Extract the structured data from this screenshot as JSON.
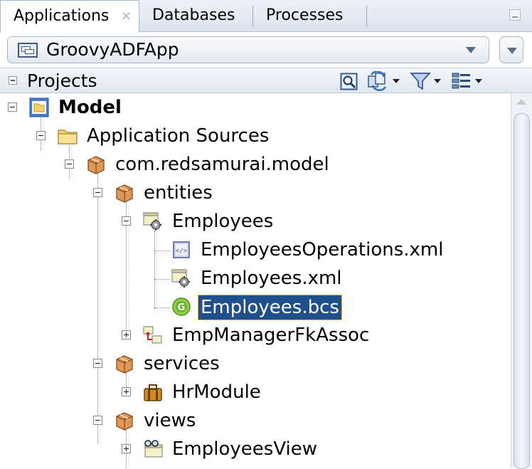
{
  "tabs": [
    {
      "label": "Applications",
      "close": "×"
    },
    {
      "label": "Databases"
    },
    {
      "label": "Processes"
    }
  ],
  "app_selector": {
    "value": "GroovyADFApp"
  },
  "projects": {
    "title": "Projects"
  },
  "tree": {
    "model": "Model",
    "application_sources": "Application Sources",
    "package": "com.redsamurai.model",
    "entities": "entities",
    "employees": "Employees",
    "employees_operations": "EmployeesOperations.xml",
    "employees_xml": "Employees.xml",
    "employees_bcs": "Employees.bcs",
    "emp_manager_fk_assoc": "EmpManagerFkAssoc",
    "services": "services",
    "hr_module": "HrModule",
    "views": "views",
    "employees_view": "EmployeesView"
  },
  "colors": {
    "selection": "#1f4f8c",
    "accent": "#3b5a86"
  }
}
